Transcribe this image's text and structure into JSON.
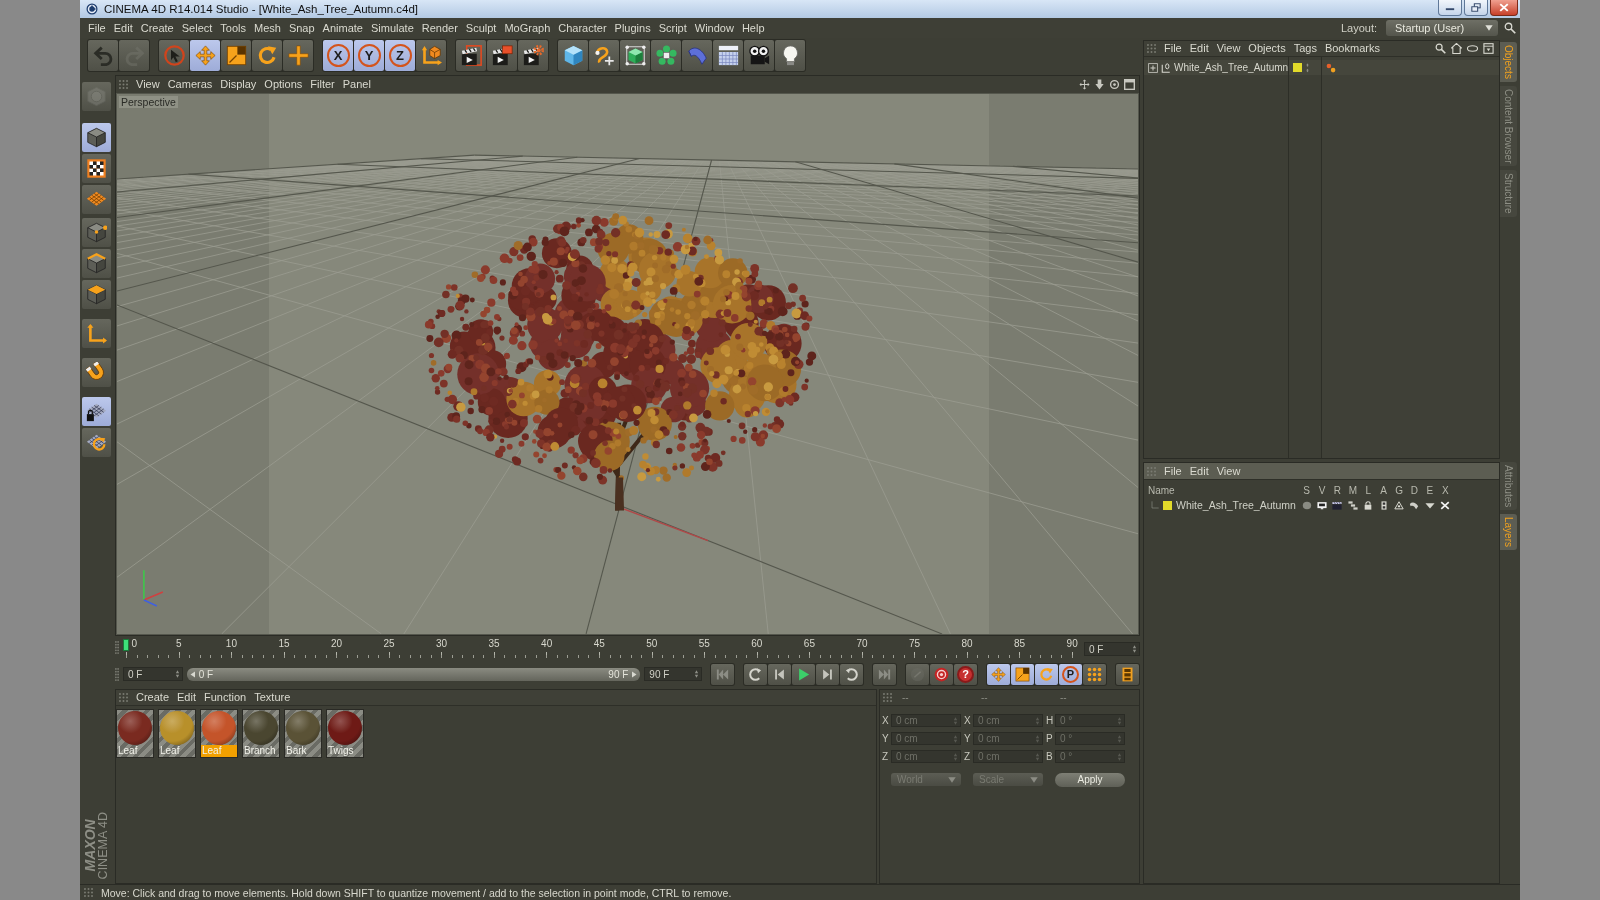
{
  "window": {
    "title": "CINEMA 4D R14.014 Studio - [White_Ash_Tree_Autumn.c4d]"
  },
  "menu_bar": {
    "items": [
      "File",
      "Edit",
      "Create",
      "Select",
      "Tools",
      "Mesh",
      "Snap",
      "Animate",
      "Simulate",
      "Render",
      "Sculpt",
      "MoGraph",
      "Character",
      "Plugins",
      "Script",
      "Window",
      "Help"
    ],
    "layout_label": "Layout:",
    "layout_value": "Startup (User)"
  },
  "toolbar": [
    [
      {
        "selected": false,
        "disabled": false
      },
      {
        "selected": false,
        "disabled": true
      }
    ],
    [
      {
        "selected": false,
        "disabled": false
      },
      {
        "selected": true,
        "disabled": false
      },
      {
        "selected": false,
        "disabled": false
      },
      {
        "selected": false,
        "disabled": false
      },
      {
        "selected": false,
        "disabled": false
      }
    ],
    [
      {
        "label": "X",
        "selected": true,
        "disabled": false
      },
      {
        "label": "Y",
        "selected": true,
        "disabled": false
      },
      {
        "label": "Z",
        "selected": true,
        "disabled": false
      },
      {
        "selected": false,
        "disabled": false
      }
    ],
    [
      {
        "selected": false,
        "disabled": false
      },
      {
        "selected": false,
        "disabled": false
      },
      {
        "selected": false,
        "disabled": false
      }
    ],
    [
      {
        "selected": false,
        "disabled": false
      },
      {
        "selected": false,
        "disabled": false
      },
      {
        "selected": false,
        "disabled": false
      },
      {
        "selected": false,
        "disabled": false
      },
      {
        "selected": false,
        "disabled": false
      },
      {
        "selected": false,
        "disabled": false
      },
      {
        "selected": false,
        "disabled": false
      },
      {
        "selected": false,
        "disabled": false
      }
    ]
  ],
  "tool_palette": [
    [
      {
        "selected": false,
        "disabled": true
      }
    ],
    [
      {
        "selected": true,
        "disabled": false
      },
      {
        "selected": false,
        "disabled": false
      },
      {
        "selected": false,
        "disabled": false
      }
    ],
    [
      {
        "selected": false,
        "disabled": false
      },
      {
        "selected": false,
        "disabled": false
      },
      {
        "selected": false,
        "disabled": false
      }
    ],
    [
      {
        "selected": false,
        "disabled": false
      }
    ],
    [
      {
        "selected": false,
        "disabled": false
      }
    ],
    [
      {
        "selected": true,
        "disabled": false
      },
      {
        "selected": false,
        "disabled": false
      }
    ]
  ],
  "viewport": {
    "menu": [
      "View",
      "Cameras",
      "Display",
      "Options",
      "Filter",
      "Panel"
    ],
    "camera": "Perspective"
  },
  "timeline": {
    "ticks": [
      "0",
      "5",
      "10",
      "15",
      "20",
      "25",
      "30",
      "35",
      "40",
      "45",
      "50",
      "55",
      "60",
      "65",
      "70",
      "75",
      "80",
      "85",
      "90"
    ],
    "playhead": {
      "level": 0
    },
    "current_frame": "0 F"
  },
  "range": {
    "start": "0 F",
    "bar_start": "0 F",
    "bar_end": "90 F",
    "end": "90 F"
  },
  "transport": [
    [
      {
        "selected": false,
        "disabled": false
      }
    ],
    [
      {
        "selected": false,
        "disabled": false
      },
      {
        "selected": false,
        "disabled": false
      },
      {
        "selected": false,
        "disabled": false
      },
      {
        "selected": false,
        "disabled": false
      },
      {
        "selected": false,
        "disabled": false
      }
    ],
    [
      {
        "selected": false,
        "disabled": false
      }
    ],
    [
      {
        "selected": false,
        "disabled": true
      },
      {
        "selected": false,
        "disabled": false
      },
      {
        "label": "?",
        "selected": false,
        "disabled": false
      }
    ],
    [
      {
        "selected": true,
        "disabled": false
      },
      {
        "selected": true,
        "disabled": false
      },
      {
        "selected": true,
        "disabled": false
      },
      {
        "label": "P",
        "selected": true,
        "disabled": false
      },
      {
        "selected": false,
        "disabled": false
      }
    ],
    [
      {
        "selected": false,
        "disabled": false
      }
    ]
  ],
  "materials": {
    "menu": [
      "Create",
      "Edit",
      "Function",
      "Texture"
    ],
    "items": [
      {
        "name": "Leaf",
        "color": "#7a2a20",
        "selected": false
      },
      {
        "name": "Leaf",
        "color": "#b8902a",
        "selected": false
      },
      {
        "name": "Leaf",
        "color": "#c4542a",
        "selected": true
      },
      {
        "name": "Branch",
        "color": "#4a4630",
        "selected": false
      },
      {
        "name": "Bark",
        "color": "#5a5236",
        "selected": false
      },
      {
        "name": "Twigs",
        "color": "#6e1a16",
        "selected": false
      }
    ]
  },
  "coordinates": {
    "disabled": true,
    "headers": [
      "--",
      "--",
      "--"
    ],
    "rows": [
      [
        {
          "axis": "X",
          "value": "0 cm"
        },
        {
          "axis": "X",
          "value": "0 cm"
        },
        {
          "axis": "H",
          "value": "0 °"
        }
      ],
      [
        {
          "axis": "Y",
          "value": "0 cm"
        },
        {
          "axis": "Y",
          "value": "0 cm"
        },
        {
          "axis": "P",
          "value": "0 °"
        }
      ],
      [
        {
          "axis": "Z",
          "value": "0 cm"
        },
        {
          "axis": "Z",
          "value": "0 cm"
        },
        {
          "axis": "B",
          "value": "0 °"
        }
      ]
    ],
    "position_mode": "World",
    "size_mode": "Scale",
    "apply": "Apply"
  },
  "object_manager": {
    "menu": [
      "File",
      "Edit",
      "View",
      "Objects",
      "Tags",
      "Bookmarks"
    ],
    "objects": [
      {
        "name": "White_Ash_Tree_Autumn",
        "color": "#e2da2a",
        "expanded": false
      }
    ]
  },
  "layer_manager": {
    "menu": [
      "File",
      "Edit",
      "View"
    ],
    "columns": [
      "Name",
      "S",
      "V",
      "R",
      "M",
      "L",
      "A",
      "G",
      "D",
      "E",
      "X"
    ],
    "layers": [
      {
        "name": "White_Ash_Tree_Autumn",
        "color": "#e2da2a"
      }
    ]
  },
  "side_tabs": {
    "upper": [
      {
        "label": "Objects",
        "selected": true
      },
      {
        "label": "Content Browser",
        "selected": false
      },
      {
        "label": "Structure",
        "selected": false
      }
    ],
    "lower": [
      {
        "label": "Attributes",
        "selected": false
      },
      {
        "label": "Layers",
        "selected": true
      }
    ]
  },
  "logo": {
    "brand": "MAXON",
    "product": "CINEMA 4D"
  },
  "status_bar": {
    "message": "Move: Click and drag to move elements. Hold down SHIFT to quantize movement / add to the selection in point mode, CTRL to remove."
  }
}
